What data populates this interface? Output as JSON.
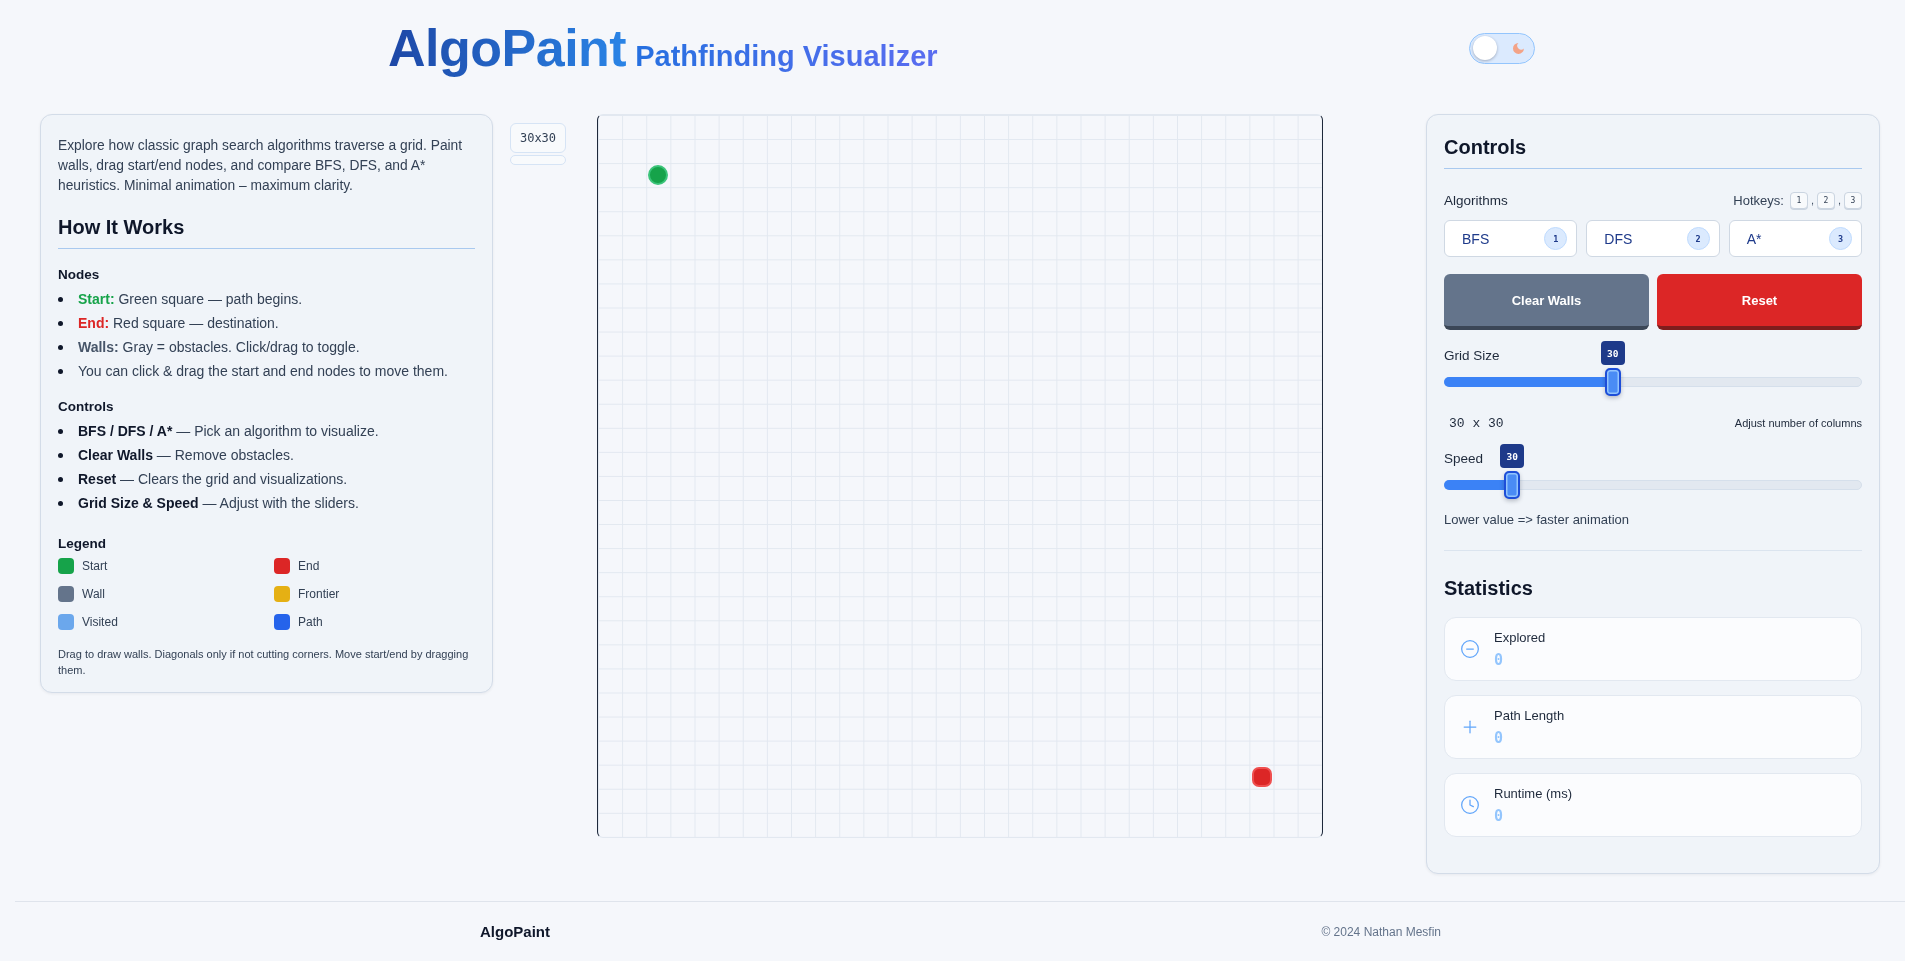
{
  "header": {
    "title": "AlgoPaint",
    "subtitle": "Pathfinding Visualizer",
    "theme_toggle": {
      "on": false
    }
  },
  "intro_panel": {
    "intro": "Explore how classic graph search algorithms traverse a grid. Paint walls, drag start/end nodes, and compare BFS, DFS, and A* heuristics. Minimal animation – maximum clarity.",
    "title": "How It Works",
    "sections": [
      {
        "title": "Nodes",
        "items": [
          {
            "term": "Start:",
            "text": " Green square — path begins.",
            "color": "#16a34a"
          },
          {
            "term": "End:",
            "text": " Red square — destination.",
            "color": "#dc2626"
          },
          {
            "term": "Walls:",
            "text": " Gray = obstacles. Click/drag to toggle.",
            "color": "#475569"
          },
          {
            "text": "You can click & drag the start and end nodes to move them."
          }
        ]
      },
      {
        "title": "Controls",
        "items": [
          {
            "term": "BFS / DFS / A*",
            "text": " — Pick an algorithm to visualize."
          },
          {
            "term": "Clear Walls",
            "text": " — Remove obstacles."
          },
          {
            "term": "Reset",
            "text": " — Clears the grid and visualizations."
          },
          {
            "term": "Grid Size & Speed",
            "text": " — Adjust with the sliders."
          }
        ]
      }
    ],
    "legend": {
      "title": "Legend",
      "items": [
        {
          "label": "Start",
          "color": "#16a34a"
        },
        {
          "label": "End",
          "color": "#dc2626"
        },
        {
          "label": "Wall",
          "color": "#64748b"
        },
        {
          "label": "Frontier",
          "color": "#e5b014"
        },
        {
          "label": "Visited",
          "color": "#6ba7ec"
        },
        {
          "label": "Path",
          "color": "#2563eb"
        }
      ]
    },
    "note": "Drag to draw walls. Diagonals only if not cutting corners. Move start/end by dragging them."
  },
  "grid_panel": {
    "size_badge": "30x30",
    "progress": {
      "level": 0
    }
  },
  "controls": {
    "title": "Controls",
    "algorithms_label": "Algorithms",
    "hotkeys": {
      "label": "Hotkeys:",
      "keys": [
        {
          "key": "1",
          "separator": ","
        },
        {
          "key": "2",
          "separator": ","
        },
        {
          "key": "3"
        }
      ]
    },
    "algorithms": [
      {
        "label": "BFS",
        "hotkey": "1",
        "selected": false
      },
      {
        "label": "DFS",
        "hotkey": "2",
        "selected": false
      },
      {
        "label": "A*",
        "hotkey": "3",
        "selected": false
      }
    ],
    "actions": [
      {
        "label": "Clear Walls",
        "kind": "secondary"
      },
      {
        "label": "Reset",
        "kind": "danger"
      }
    ],
    "grid_size": {
      "label": "Grid Size",
      "value": "30",
      "level": 0.4,
      "reading": "30 x 30",
      "hint": "Adjust number of columns"
    },
    "speed": {
      "label": "Speed",
      "value": "30",
      "level": 0.15,
      "hint": "Lower value => faster animation"
    }
  },
  "statistics": {
    "title": "Statistics",
    "items": [
      {
        "label": "Explored",
        "value": "0"
      },
      {
        "label": "Path Length",
        "value": "0"
      },
      {
        "label": "Runtime (ms)",
        "value": "0"
      }
    ]
  },
  "footer": {
    "brand": "AlgoPaint",
    "copyright": "© 2024 Nathan Mesfin"
  }
}
